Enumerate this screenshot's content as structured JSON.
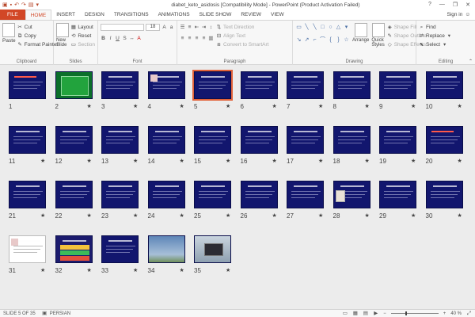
{
  "window": {
    "title": "diabet_keto_asidosis [Compatibility Mode] - PowerPoint (Product Activation Failed)",
    "help": "?",
    "minimize": "—",
    "restore": "❐",
    "close": "✕"
  },
  "tabs": [
    "FILE",
    "HOME",
    "INSERT",
    "DESIGN",
    "TRANSITIONS",
    "ANIMATIONS",
    "SLIDE SHOW",
    "REVIEW",
    "VIEW"
  ],
  "active_tab": "HOME",
  "signin": "Sign in",
  "ribbon": {
    "clipboard": {
      "paste": "Paste",
      "cut": "Cut",
      "copy": "Copy",
      "format_painter": "Format Painter",
      "label": "Clipboard"
    },
    "slides": {
      "new_slide": "New Slide",
      "layout": "Layout",
      "reset": "Reset",
      "section": "Section",
      "label": "Slides"
    },
    "font": {
      "font_name": "",
      "font_size": "18",
      "label": "Font"
    },
    "paragraph": {
      "text_direction": "Text Direction",
      "align_text": "Align Text",
      "convert_smartart": "Convert to SmartArt",
      "label": "Paragraph"
    },
    "drawing": {
      "arrange": "Arrange",
      "quick_styles": "Quick Styles",
      "shape_fill": "Shape Fill",
      "shape_outline": "Shape Outline",
      "shape_effects": "Shape Effects",
      "label": "Drawing"
    },
    "editing": {
      "find": "Find",
      "replace": "Replace",
      "select": "Select",
      "label": "Editing"
    }
  },
  "slides": [
    {
      "n": "1",
      "star": ""
    },
    {
      "n": "2",
      "star": "★"
    },
    {
      "n": "3",
      "star": "★"
    },
    {
      "n": "4",
      "star": "★"
    },
    {
      "n": "5",
      "star": "★"
    },
    {
      "n": "6",
      "star": "★"
    },
    {
      "n": "7",
      "star": "★"
    },
    {
      "n": "8",
      "star": "★"
    },
    {
      "n": "9",
      "star": "★"
    },
    {
      "n": "10",
      "star": "★"
    },
    {
      "n": "11",
      "star": "★"
    },
    {
      "n": "12",
      "star": "★"
    },
    {
      "n": "13",
      "star": "★"
    },
    {
      "n": "14",
      "star": "★"
    },
    {
      "n": "15",
      "star": "★"
    },
    {
      "n": "16",
      "star": "★"
    },
    {
      "n": "17",
      "star": "★"
    },
    {
      "n": "18",
      "star": "★"
    },
    {
      "n": "19",
      "star": "★"
    },
    {
      "n": "20",
      "star": "★"
    },
    {
      "n": "21",
      "star": "★"
    },
    {
      "n": "22",
      "star": "★"
    },
    {
      "n": "23",
      "star": "★"
    },
    {
      "n": "24",
      "star": "★"
    },
    {
      "n": "25",
      "star": "★"
    },
    {
      "n": "26",
      "star": "★"
    },
    {
      "n": "27",
      "star": "★"
    },
    {
      "n": "28",
      "star": "★"
    },
    {
      "n": "29",
      "star": "★"
    },
    {
      "n": "30",
      "star": "★"
    },
    {
      "n": "31",
      "star": "★"
    },
    {
      "n": "32",
      "star": "★"
    },
    {
      "n": "33",
      "star": "★"
    },
    {
      "n": "34",
      "star": "★"
    },
    {
      "n": "35",
      "star": "★"
    }
  ],
  "selected_slide": "5",
  "status": {
    "slide_of": "SLIDE 5 OF 35",
    "language": "PERSIAN",
    "zoom": "40 %",
    "zoom_minus": "−",
    "zoom_plus": "+"
  },
  "colors": {
    "file_tab": "#d24726",
    "slide_bg": "#12166e",
    "selection": "#e2633a"
  }
}
